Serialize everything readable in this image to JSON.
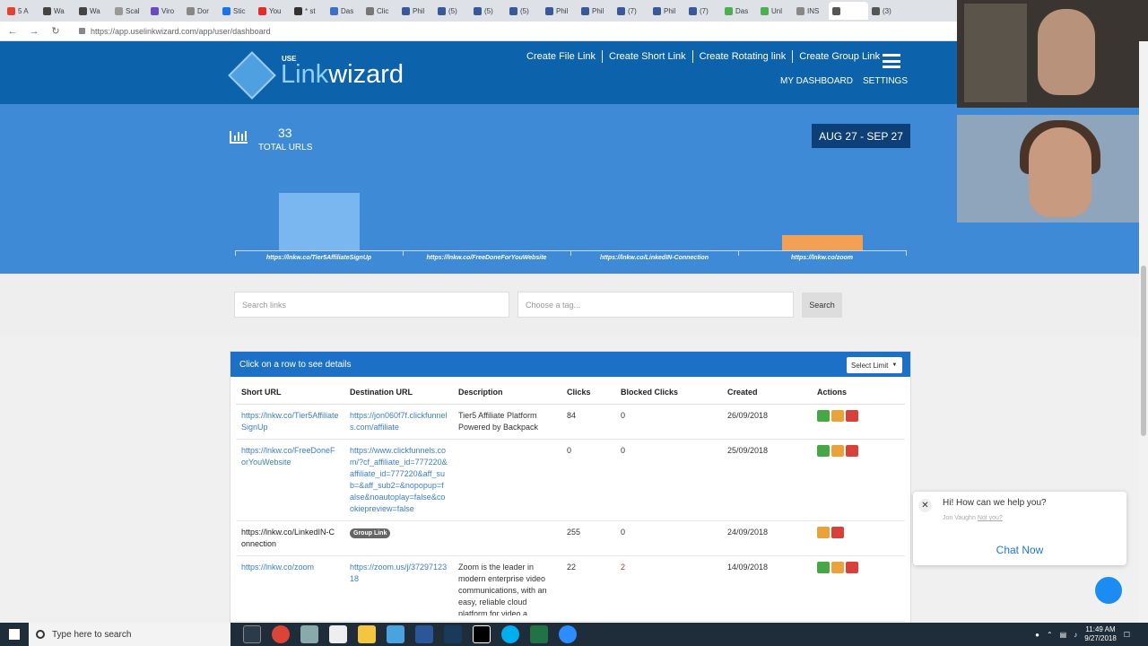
{
  "browser": {
    "tabs": [
      {
        "label": "5 A",
        "color": "#e0442f"
      },
      {
        "label": "Wa",
        "color": "#444"
      },
      {
        "label": "Wa",
        "color": "#444"
      },
      {
        "label": "Scal",
        "color": "#999"
      },
      {
        "label": "Viro",
        "color": "#6a4bc4"
      },
      {
        "label": "Dor",
        "color": "#888"
      },
      {
        "label": "Stic",
        "color": "#1a73e8"
      },
      {
        "label": "You",
        "color": "#e52d27"
      },
      {
        "label": "* st",
        "color": "#333"
      },
      {
        "label": "Das",
        "color": "#3d6fc7"
      },
      {
        "label": "Clic",
        "color": "#777"
      },
      {
        "label": "Phil",
        "color": "#3b5998"
      },
      {
        "label": "(5)",
        "color": "#3b5998"
      },
      {
        "label": "(5)",
        "color": "#3b5998"
      },
      {
        "label": "(5)",
        "color": "#3b5998"
      },
      {
        "label": "Phil",
        "color": "#3b5998"
      },
      {
        "label": "Phil",
        "color": "#3b5998"
      },
      {
        "label": "(7)",
        "color": "#3b5998"
      },
      {
        "label": "Phil",
        "color": "#3b5998"
      },
      {
        "label": "(7)",
        "color": "#3b5998"
      },
      {
        "label": "Das",
        "color": "#4caf50"
      },
      {
        "label": "Unl",
        "color": "#4caf50"
      },
      {
        "label": "INS",
        "color": "#888"
      },
      {
        "label": "",
        "color": "#555"
      },
      {
        "label": "(3)",
        "color": "#555"
      }
    ],
    "url": "https://app.uselinkwizard.com/app/user/dashboard"
  },
  "header": {
    "logo_use": "USE",
    "logo_link": "Link",
    "logo_wizard": "wizard",
    "nav": [
      "Create File Link",
      "Create Short Link",
      "Create Rotating link",
      "Create Group Link"
    ],
    "my_dashboard": "MY DASHBOARD",
    "settings": "SETTINGS"
  },
  "stats": {
    "total": "33",
    "total_label": "TOTAL URLS",
    "date_range": "AUG 27 - SEP 27"
  },
  "chart_data": {
    "type": "bar",
    "categories": [
      "https://lnkw.co/Tier5AffiliateSignUp",
      "https://lnkw.co/FreeDoneForYouWebsite",
      "https://lnkw.co/LinkedIN-Connection",
      "https://lnkw.co/zoom"
    ],
    "values": [
      84,
      0,
      0,
      22
    ],
    "colors": [
      "#7ab6f0",
      "#7ab6f0",
      "#7ab6f0",
      "#f2a154"
    ],
    "title": "",
    "xlabel": "",
    "ylabel": ""
  },
  "search": {
    "placeholder": "Search links",
    "tag_placeholder": "Choose a tag...",
    "button": "Search"
  },
  "table": {
    "caption": "Click on a row to see details",
    "limit": "Select Limit",
    "columns": [
      "Short URL",
      "Destination URL",
      "Description",
      "Clicks",
      "Blocked Clicks",
      "Created",
      "Actions"
    ],
    "rows": [
      {
        "short": "https://lnkw.co/Tier5AffiliateSignUp",
        "dest": "https://jon060f7f.clickfunnels.com/affiliate",
        "desc": "Tier5 Affiliate Platform Powered by Backpack",
        "clicks": "84",
        "blocked": "0",
        "created": "26/09/2018"
      },
      {
        "short": "https://lnkw.co/FreeDoneForYouWebsite",
        "dest": "https://www.clickfunnels.com/?cf_affiliate_id=777220&affiliate_id=777220&aff_sub=&aff_sub2=&nopopup=false&noautoplay=false&cookiepreview=false",
        "desc": "",
        "clicks": "0",
        "blocked": "0",
        "created": "25/09/2018"
      },
      {
        "short": "https://lnkw.co/LinkedIN-Connection",
        "badge": "Group Link",
        "clicks": "255",
        "blocked": "0",
        "created": "24/09/2018"
      },
      {
        "short": "https://lnkw.co/zoom",
        "dest": "https://zoom.us/j/3729712318",
        "desc": "Zoom is the leader in modern enterprise video communications, with an easy, reliable cloud platform for video a",
        "clicks": "22",
        "blocked": "2",
        "created": "14/09/2018"
      }
    ]
  },
  "chat": {
    "message": "Hi! How can we help you?",
    "agent": "Jon Vaughn",
    "agent_status": "Not you?",
    "cta": "Chat Now"
  },
  "taskbar": {
    "search_placeholder": "Type here to search",
    "time": "11:49 AM",
    "date": "9/27/2018"
  }
}
